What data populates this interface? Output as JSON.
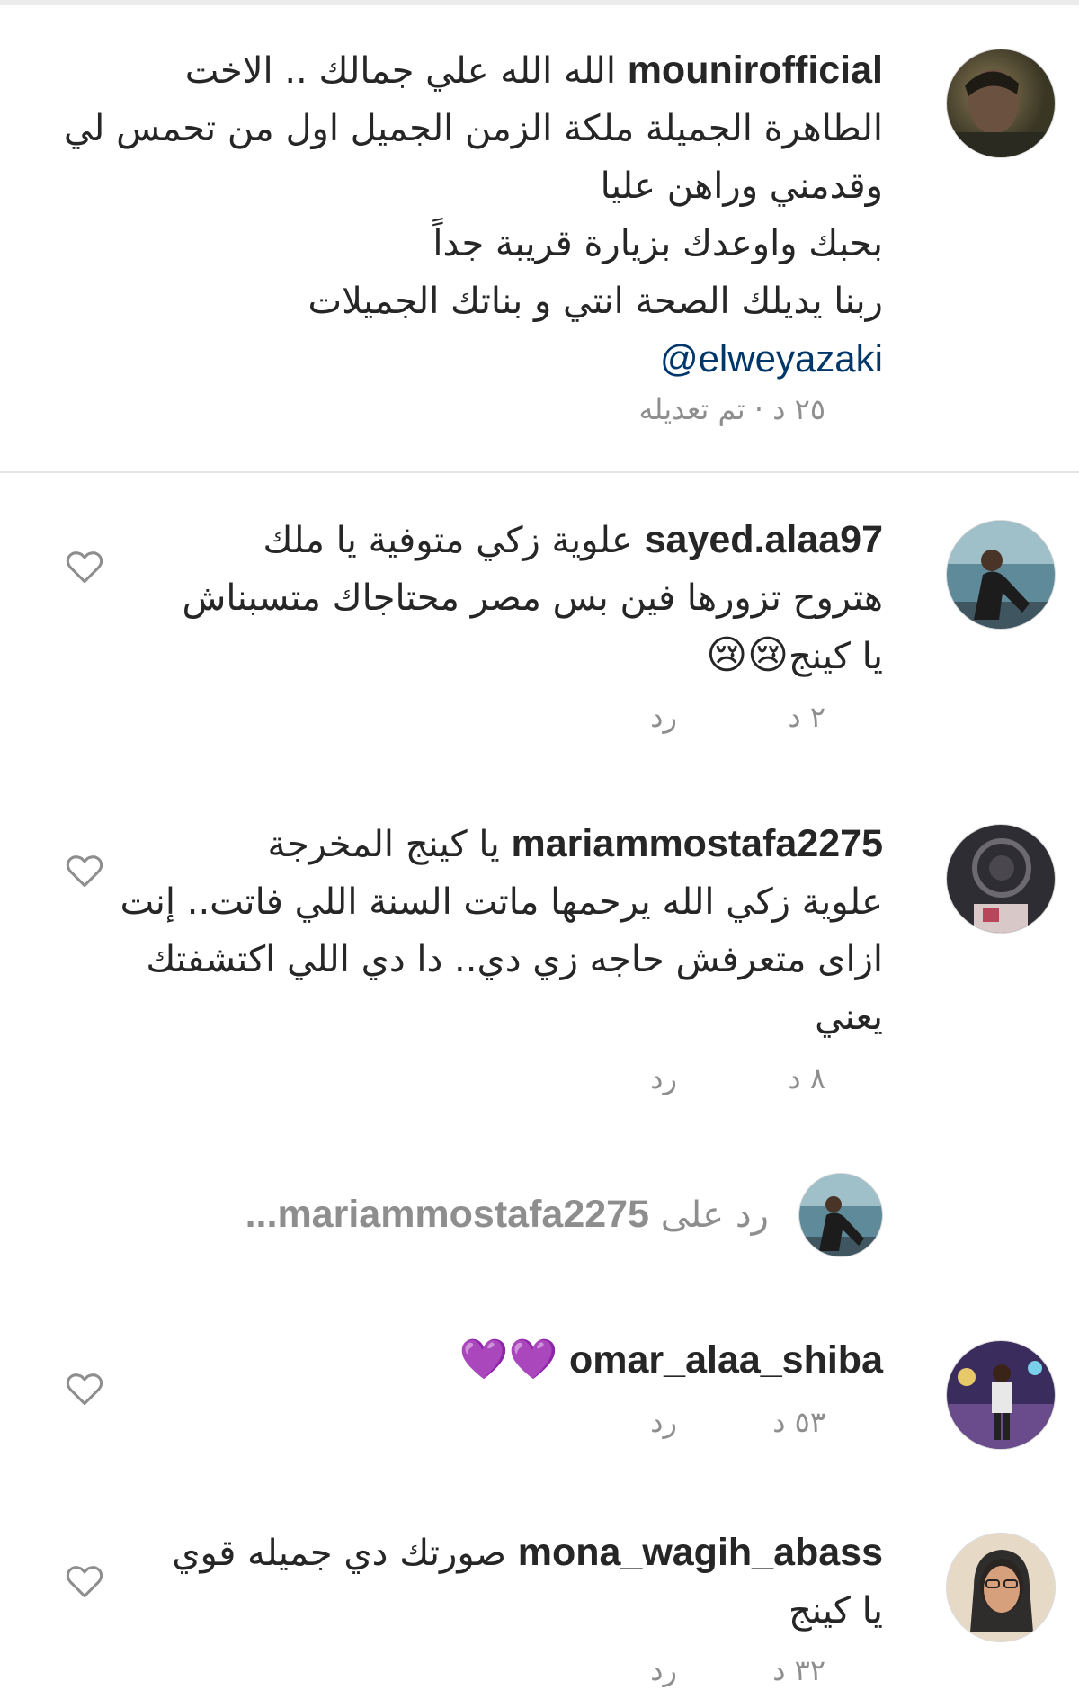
{
  "comments": [
    {
      "username": "mounirofficial",
      "lines": [
        "الله الله علي جمالك .. الاخت",
        "الطاهرة الجميلة ملكة الزمن الجميل اول من تحمس لي",
        "وقدمني وراهن عليا",
        "بحبك واوعدك بزيارة قريبة جداً",
        "ربنا يديلك الصحة انتي و بناتك الجميلات"
      ],
      "mention": "@elweyazaki",
      "meta": "٢٥ د · تم تعديله"
    },
    {
      "username": "sayed.alaa97",
      "lines": [
        "علوية زكي متوفية يا ملك",
        "هتروح تزورها فين بس مصر محتاجاك متسبناش",
        "يا كينج"
      ],
      "emoji": "😢😢",
      "time": "٢ د",
      "reply_label": "رد"
    },
    {
      "username": "mariammostafa2275",
      "lines": [
        "يا كينج المخرجة",
        "علوية زكي الله يرحمها ماتت السنة اللي فاتت.. إنت",
        "ازاى متعرفش حاجه زي دي.. دا دي اللي اكتشفتك",
        "يعني"
      ],
      "time": "٨ د",
      "reply_label": "رد"
    },
    {
      "replied_prefix": "رد على",
      "replied_user": "mariammostafa2275..."
    },
    {
      "username": "omar_alaa_shiba",
      "emoji": "💜💜",
      "time": "٥٣ د",
      "reply_label": "رد"
    },
    {
      "username": "mona_wagih_abass",
      "lines": [
        "صورتك دي جميله قوي",
        "يا كينج"
      ],
      "time": "٣٢ د",
      "reply_label": "رد"
    }
  ],
  "colors": {
    "text": "#262626",
    "muted": "#8e8e8e",
    "mention": "#00376b",
    "divider": "#e4e4e4"
  }
}
